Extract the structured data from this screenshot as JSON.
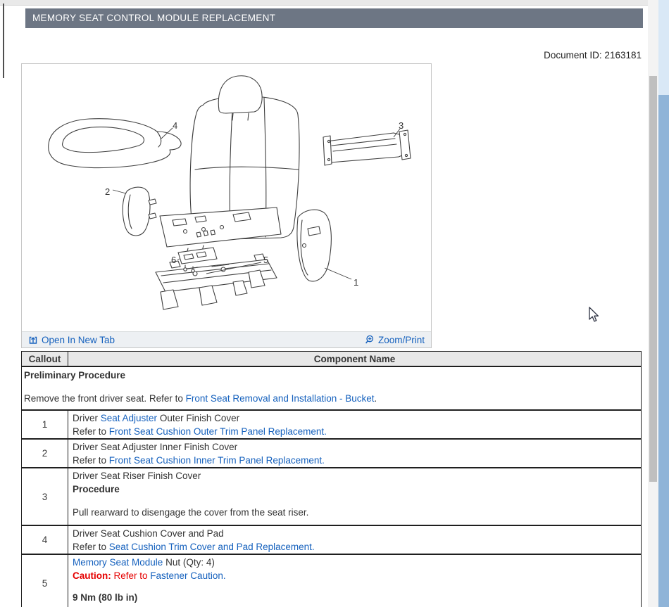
{
  "header": {
    "title": "MEMORY SEAT CONTROL MODULE REPLACEMENT"
  },
  "document_id": "Document ID: 2163181",
  "figure": {
    "open_in_new_tab": "Open In New Tab",
    "zoom_print": "Zoom/Print",
    "callouts": [
      "1",
      "2",
      "3",
      "4",
      "5",
      "6"
    ]
  },
  "table": {
    "headers": {
      "callout": "Callout",
      "component": "Component Name"
    },
    "preliminary": {
      "title": "Preliminary Procedure",
      "text": "Remove the front driver seat. Refer to ",
      "link": "Front Seat Removal and Installation - Bucket",
      "after": "."
    },
    "rows": [
      {
        "callout": "1",
        "l1a": "Driver ",
        "l1link": "Seat Adjuster",
        "l1b": " Outer Finish Cover",
        "l2a": "Refer to ",
        "l2link": "Front Seat Cushion Outer Trim Panel Replacement."
      },
      {
        "callout": "2",
        "l1": "Driver Seat Adjuster Inner Finish Cover",
        "l2a": "Refer to ",
        "l2link": "Front Seat Cushion Inner Trim Panel Replacement."
      },
      {
        "callout": "3",
        "l1": "Driver Seat Riser Finish Cover",
        "l2": "Procedure",
        "l3": "Pull rearward to disengage the cover from the seat riser."
      },
      {
        "callout": "4",
        "l1": "Driver Seat Cushion Cover and Pad",
        "l2a": "Refer to ",
        "l2link": "Seat Cushion Trim Cover and Pad Replacement."
      },
      {
        "callout": "5",
        "l1link": "Memory Seat Module",
        "l1b": " Nut (Qty: 4)",
        "l2a": "Caution:",
        "l2b": " Refer to ",
        "l2link": "Fastener Caution.",
        "l4": "9 Nm (80 lb in)"
      }
    ]
  },
  "colors": {
    "titlebar_bg": "#6d7684",
    "link_blue": "#1460bd",
    "caution_red": "#e50000"
  }
}
